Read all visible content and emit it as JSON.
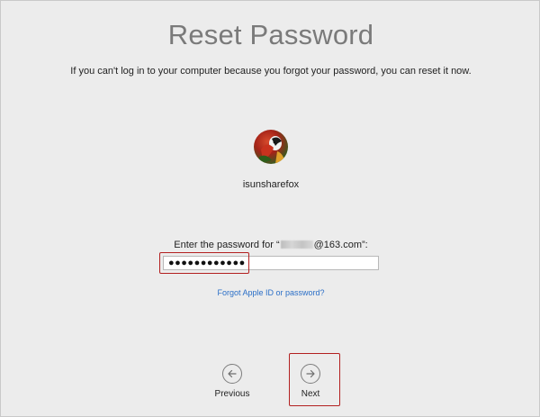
{
  "title": "Reset Password",
  "subtitle": "If you can't log in to your computer because you forgot your password, you can reset it now.",
  "user": {
    "username": "isunsharefox",
    "avatar_icon": "parrot-avatar-icon"
  },
  "password_prompt": {
    "prefix": "Enter the password for “",
    "email_suffix": "@163.com",
    "suffix": "”:"
  },
  "password_field": {
    "masked_value": "●●●●●●●●●●●●"
  },
  "forgot_link": "Forgot Apple ID or password?",
  "buttons": {
    "previous_label": "Previous",
    "previous_icon": "arrow-left-icon",
    "next_label": "Next",
    "next_icon": "arrow-right-icon"
  },
  "colors": {
    "background": "#ececec",
    "title": "#7a7a7a",
    "link": "#2b6fc7",
    "highlight": "#b32020"
  }
}
